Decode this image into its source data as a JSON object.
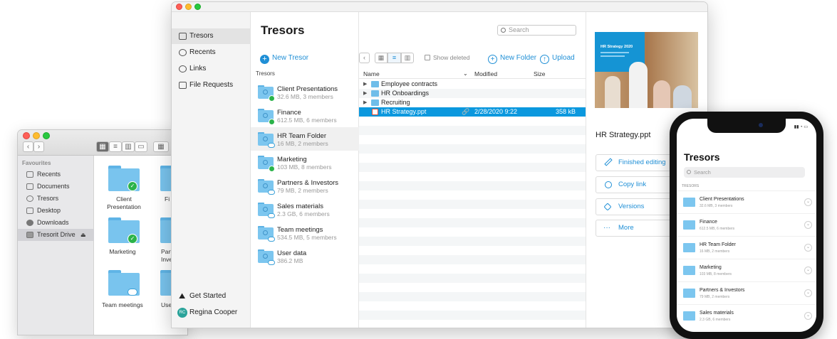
{
  "finder": {
    "sidebar_header": "Favourites",
    "items": [
      {
        "label": "Recents",
        "icon": "recents-icon"
      },
      {
        "label": "Documents",
        "icon": "documents-icon"
      },
      {
        "label": "Tresors",
        "icon": "tresors-icon"
      },
      {
        "label": "Desktop",
        "icon": "desktop-icon"
      },
      {
        "label": "Downloads",
        "icon": "downloads-icon"
      },
      {
        "label": "Tresorit Drive",
        "icon": "drive-icon",
        "selected": true
      }
    ],
    "eject": "⏏",
    "folders": [
      {
        "label": "Client Presentation",
        "status": "synced"
      },
      {
        "label": "Fi",
        "status": "none"
      },
      {
        "label": "Marketing",
        "status": "synced"
      },
      {
        "label": "Part Inve",
        "status": "none"
      },
      {
        "label": "Team meetings",
        "status": "cloud"
      },
      {
        "label": "Use",
        "status": "none"
      }
    ]
  },
  "app": {
    "sidebar": {
      "items": [
        {
          "label": "Tresors",
          "icon": "tresors-icon",
          "selected": true
        },
        {
          "label": "Recents",
          "icon": "clock-icon"
        },
        {
          "label": "Links",
          "icon": "link-icon"
        },
        {
          "label": "File Requests",
          "icon": "inbox-icon"
        }
      ],
      "get_started": "Get Started",
      "user": {
        "initials": "RC",
        "name": "Regina Cooper"
      }
    },
    "tresors": {
      "title": "Tresors",
      "new_button": "New Tresor",
      "column_header": "Tresors",
      "list": [
        {
          "name": "Client Presentations",
          "meta": "32.6 MB, 3 members",
          "status": "synced"
        },
        {
          "name": "Finance",
          "meta": "612.5 MB, 6 members",
          "status": "synced"
        },
        {
          "name": "HR Team Folder",
          "meta": "16 MB, 2 members",
          "status": "cloud",
          "selected": true
        },
        {
          "name": "Marketing",
          "meta": "103 MB, 8 members",
          "status": "synced"
        },
        {
          "name": "Partners & Investors",
          "meta": "79 MB, 2 members",
          "status": "cloud"
        },
        {
          "name": "Sales materials",
          "meta": "2.3 GB, 6 members",
          "status": "cloud"
        },
        {
          "name": "Team meetings",
          "meta": "534.5 MB, 5 members",
          "status": "cloud"
        },
        {
          "name": "User data",
          "meta": "386.2 MB",
          "status": "cloud"
        }
      ]
    },
    "files": {
      "search_placeholder": "Search",
      "show_deleted": "Show deleted",
      "new_folder": "New Folder",
      "upload": "Upload",
      "columns": {
        "name": "Name",
        "modified": "Modified",
        "size": "Size"
      },
      "rows": [
        {
          "name": "Employee contracts",
          "type": "folder",
          "modified": "",
          "size": ""
        },
        {
          "name": "HR Onboardings",
          "type": "folder",
          "modified": "",
          "size": ""
        },
        {
          "name": "Recruiting",
          "type": "folder",
          "modified": "",
          "size": ""
        },
        {
          "name": "HR Strategy.ppt",
          "type": "file",
          "modified": "2/28/2020 9:22",
          "size": "358 kB",
          "selected": true
        }
      ]
    },
    "preview": {
      "thumb_title": "HR Strategy 2020",
      "file_name": "HR Strategy.ppt",
      "actions": [
        {
          "label": "Finished editing",
          "icon": "edit-icon"
        },
        {
          "label": "Copy link",
          "icon": "link-icon"
        },
        {
          "label": "Versions",
          "icon": "layers-icon"
        },
        {
          "label": "More",
          "icon": "more-icon"
        }
      ]
    }
  },
  "phone": {
    "title": "Tresors",
    "search_placeholder": "Search",
    "section": "TRESORS",
    "list": [
      {
        "name": "Client Presentations",
        "meta": "32.6 MB, 3 members"
      },
      {
        "name": "Finance",
        "meta": "612.5 MB, 6 members"
      },
      {
        "name": "HR Team Folder",
        "meta": "16 MB, 2 members"
      },
      {
        "name": "Marketing",
        "meta": "103 MB, 8 members"
      },
      {
        "name": "Partners & Investors",
        "meta": "79 MB, 2 members"
      },
      {
        "name": "Sales materials",
        "meta": "2.3 GB, 6 members"
      }
    ]
  },
  "colors": {
    "accent": "#1f8fd6",
    "selection": "#0b98de",
    "folder": "#7cc6ef",
    "synced": "#2bb34a"
  }
}
